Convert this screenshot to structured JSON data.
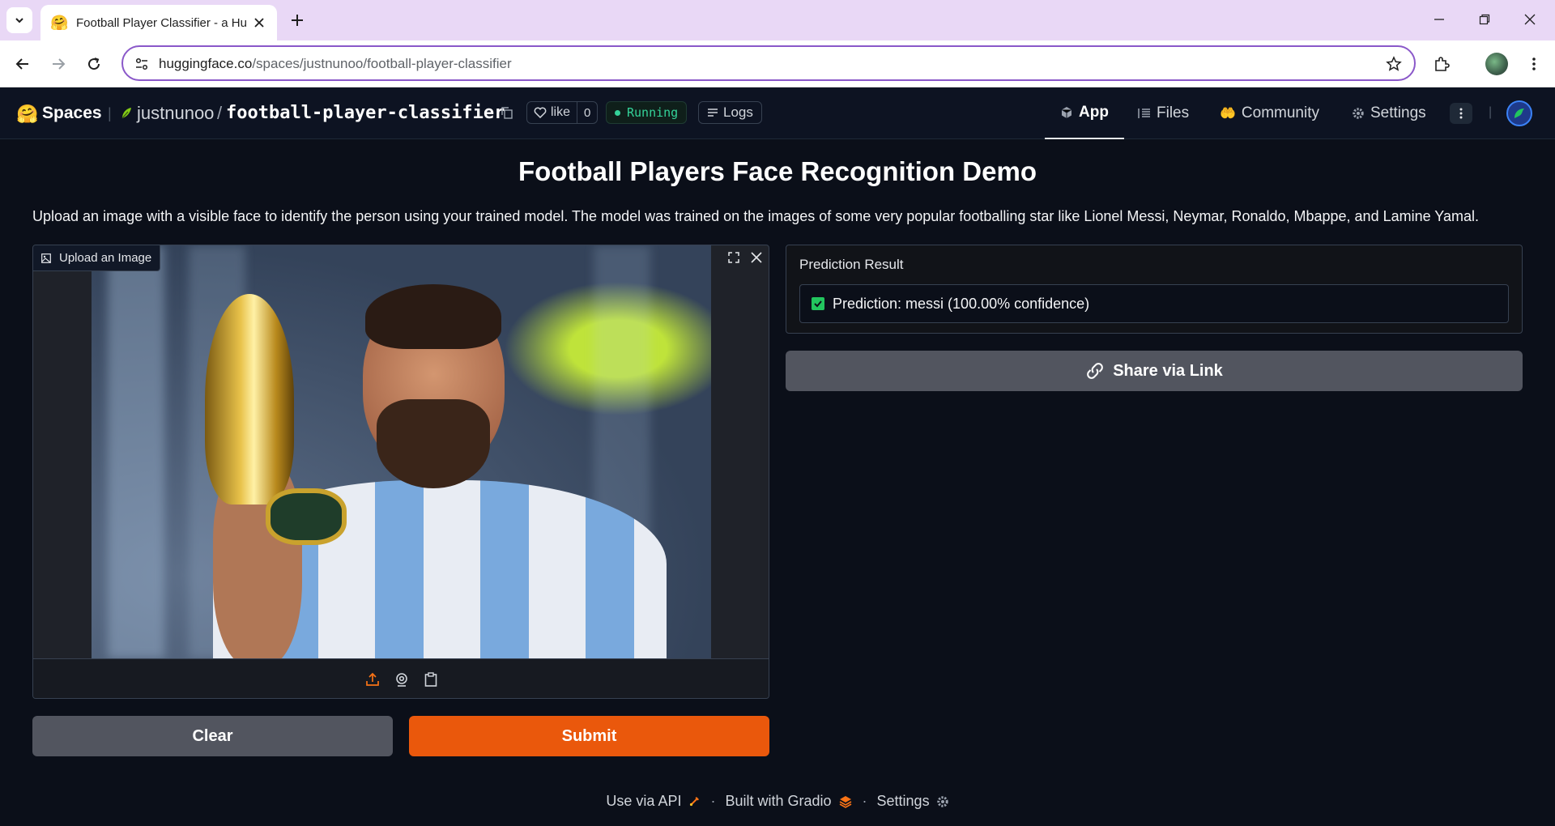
{
  "browser": {
    "tab_title": "Football Player Classifier - a Hu",
    "tab_favicon": "🤗",
    "url_domain": "huggingface.co",
    "url_path": "/spaces/justnunoo/football-player-classifier"
  },
  "hf_header": {
    "logo": "🤗",
    "spaces_label": "Spaces",
    "owner": "justnunoo",
    "slash": "/",
    "repo": "football-player-classifier",
    "like_label": "like",
    "like_count": "0",
    "status": "Running",
    "logs_label": "Logs",
    "nav": {
      "app": "App",
      "files": "Files",
      "community": "Community",
      "settings": "Settings"
    },
    "community_icon": "🤲"
  },
  "app": {
    "title": "Football Players Face Recognition Demo",
    "description": "Upload an image with a visible face to identify the person using your trained model. The model was trained on the images of some very popular footballing star like Lionel Messi, Neymar, Ronaldo, Mbappe, and Lamine Yamal.",
    "upload_label": "Upload an Image",
    "prediction_label": "Prediction Result",
    "prediction_text": "Prediction: messi (100.00% confidence)",
    "share_label": "Share via Link",
    "clear_label": "Clear",
    "submit_label": "Submit"
  },
  "footer": {
    "api": "Use via API",
    "built": "Built with Gradio",
    "settings": "Settings",
    "sep": "·"
  },
  "colors": {
    "accent": "#ea580c",
    "status_green": "#34d399",
    "bg": "#0b0f19"
  }
}
